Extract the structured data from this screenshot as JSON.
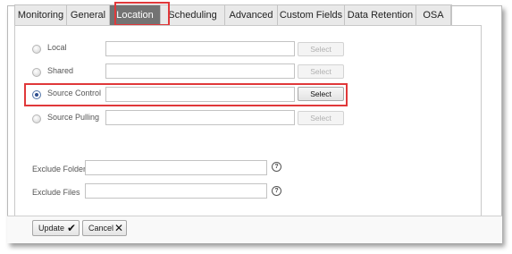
{
  "tabs": [
    {
      "label": "Monitoring",
      "active": false
    },
    {
      "label": "General",
      "active": false
    },
    {
      "label": "Location",
      "active": true
    },
    {
      "label": "Scheduling",
      "active": false
    },
    {
      "label": "Advanced",
      "active": false
    },
    {
      "label": "Custom Fields",
      "active": false
    },
    {
      "label": "Data Retention",
      "active": false
    },
    {
      "label": "OSA",
      "active": false
    }
  ],
  "location_options": [
    {
      "label": "Local",
      "selected": false,
      "path_value": "",
      "select_label": "Select",
      "select_enabled": false
    },
    {
      "label": "Shared",
      "selected": false,
      "path_value": "",
      "select_label": "Select",
      "select_enabled": false
    },
    {
      "label": "Source Control",
      "selected": true,
      "path_value": "",
      "select_label": "Select",
      "select_enabled": true
    },
    {
      "label": "Source Pulling",
      "selected": false,
      "path_value": "",
      "select_label": "Select",
      "select_enabled": false
    }
  ],
  "exclusions": {
    "folders_label": "Exclude Folders",
    "folders_value": "",
    "files_label": "Exclude Files",
    "files_value": "",
    "help_glyph": "?"
  },
  "footer": {
    "update_label": "Update",
    "update_icon": "check-icon",
    "cancel_label": "Cancel",
    "cancel_icon": "close-icon"
  },
  "colors": {
    "active_tab_bg": "#737373",
    "highlight_red": "#e0383a",
    "radio_selected": "#2f4f8f"
  }
}
